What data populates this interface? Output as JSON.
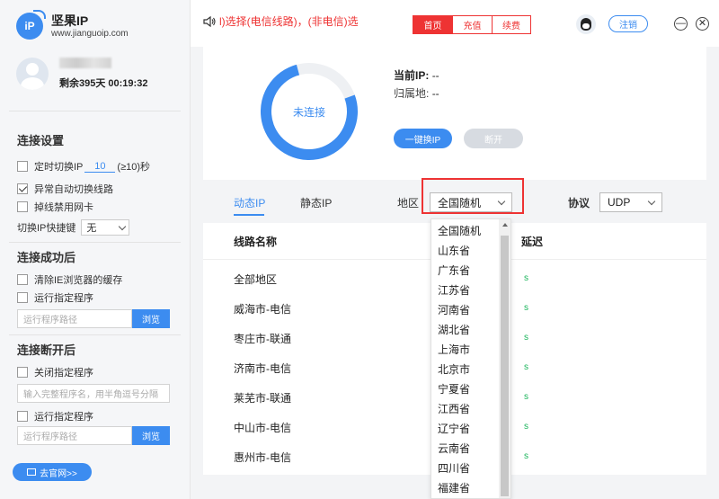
{
  "app": {
    "name": "坚果IP",
    "url": "www.jianguoip.com"
  },
  "user": {
    "remaining": "剩余395天 00:19:32"
  },
  "sidebar": {
    "connection_settings": {
      "title": "连接设置",
      "timed_switch_pre": "定时切换IP",
      "timed_switch_value": "10",
      "timed_switch_post": "(≥10)秒",
      "auto_switch": "异常自动切换线路",
      "disable_nic": "掉线禁用网卡",
      "hotkey_label": "切换IP快捷键",
      "hotkey_value": "无"
    },
    "after_connect": {
      "title": "连接成功后",
      "clear_ie_cache": "清除IE浏览器的缓存",
      "run_program": "运行指定程序",
      "path_placeholder": "运行程序路径",
      "browse": "浏览"
    },
    "after_disconnect": {
      "title": "连接断开后",
      "close_program": "关闭指定程序",
      "program_names_placeholder": "输入完整程序名，用半角逗号分隔",
      "run_program": "运行指定程序",
      "path_placeholder": "运行程序路径",
      "browse": "浏览"
    },
    "website_button": "去官网>>"
  },
  "topbar": {
    "marquee": "l)选择(电信线路)，(非电信)选",
    "tabs": [
      "首页",
      "充值",
      "续费"
    ],
    "logout": "注销",
    "minimize": "—",
    "close": "✕"
  },
  "connection": {
    "status": "未连接",
    "current_ip_label": "当前IP:",
    "current_ip_value": "--",
    "location_label": "归属地:",
    "location_value": "--",
    "switch_button": "一键换IP",
    "disconnect_button": "断开"
  },
  "filters": {
    "dynamic_ip": "动态IP",
    "static_ip": "静态IP",
    "region_label": "地区",
    "region_value": "全国随机",
    "protocol_label": "协议",
    "protocol_value": "UDP"
  },
  "line_list": {
    "header_name": "线路名称",
    "header_latency": "延迟",
    "rows": [
      "全部地区",
      "威海市-电信",
      "枣庄市-联通",
      "济南市-电信",
      "莱芜市-联通",
      "中山市-电信",
      "惠州市-电信"
    ],
    "latency": [
      "s",
      "s",
      "s",
      "s",
      "s",
      "s",
      "s"
    ]
  },
  "region_dropdown": {
    "options": [
      "全国随机",
      "山东省",
      "广东省",
      "江苏省",
      "河南省",
      "湖北省",
      "上海市",
      "北京市",
      "宁夏省",
      "江西省",
      "辽宁省",
      "云南省",
      "四川省",
      "福建省"
    ]
  },
  "colors": {
    "accent": "#3c8cf0",
    "danger": "#e33333",
    "success": "#19b45a"
  }
}
